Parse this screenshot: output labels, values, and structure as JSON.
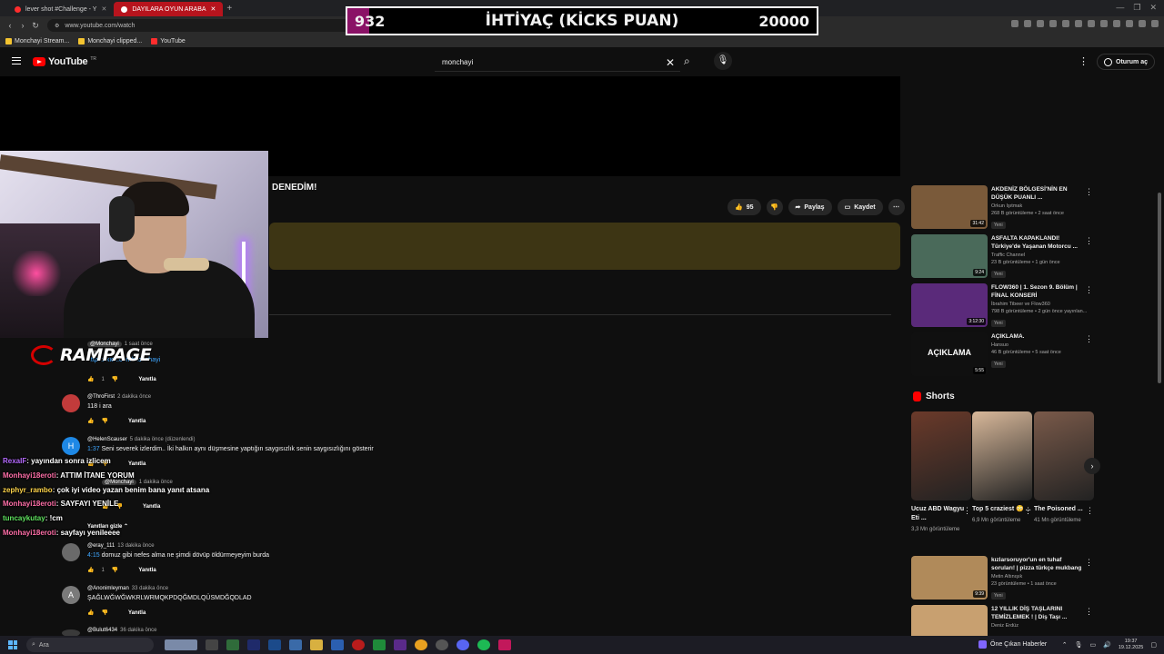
{
  "browser": {
    "tabs": [
      {
        "label": "lever shot #Challenge - Y",
        "active": false
      },
      {
        "label": "DAYILARA OYUN ARABA",
        "active": true
      }
    ],
    "url": "www.youtube.com/watch",
    "bookmarks": [
      "Monchayi Stream...",
      "Monchayi clipped...",
      "YouTube"
    ]
  },
  "overlay": {
    "current": "932",
    "label": "İHTİYAÇ (KİCKS PUAN)",
    "goal": "20000",
    "progress_fraction": 0.047,
    "accent": "#8a1266"
  },
  "youtube": {
    "logo_text": "YouTube",
    "country": "TR",
    "search_value": "monchayi",
    "sign_in": "Oturum aç"
  },
  "video": {
    "title_fragment": "DENEDİM!",
    "likes": "95",
    "share": "Paylaş",
    "save": "Kaydet"
  },
  "branding": {
    "rampage": "RAMPAGE"
  },
  "comments": [
    {
      "avatar": "",
      "user": "@Monchayi",
      "ago": "1 saat önce",
      "text": "GEL",
      "link": "https://kick.com/monchayi",
      "likes": "1",
      "reply": "Yanıtla"
    },
    {
      "avatar": "",
      "user": "@ThroFirst",
      "ago": "2 dakika önce",
      "text": "118 i ara",
      "likes": "",
      "reply": "Yanıtla"
    },
    {
      "avatar": "H",
      "user": "@HelenScauser",
      "ago": "5 dakika önce (düzenlendi)",
      "ts": "1:37",
      "text": "Seni severek izlerdim.. İki halkın aynı düşmesine yaptığın saygısızlık senin saygısızlığını gösterir",
      "likes": "",
      "reply": "Yanıtla"
    },
    {
      "avatar": "",
      "user": "@Monchayi",
      "ago": "1 dakika önce",
      "text": "",
      "likes": "",
      "reply": "Yanıtla"
    },
    {
      "avatar": "",
      "user": "@eray_111",
      "ago": "13 dakika önce",
      "ts": "4:15",
      "text": "domuz gibi nefes alma ne şimdi dövüp öldürmeyeyim burda",
      "likes": "1",
      "reply": "Yanıtla"
    },
    {
      "avatar": "A",
      "user": "@Anonimleyman",
      "ago": "33 dakika önce",
      "text": "ŞAĞLWĞWĞWKRLWRMQKPDQĞMDLQÜSMDĞQDLAD",
      "likes": "",
      "reply": "Yanıtla"
    },
    {
      "avatar": "",
      "user": "@Bulut6434",
      "ago": "36 dakika önce",
      "text": "",
      "likes": "",
      "reply": ""
    }
  ],
  "replies_toggle": "Yanıtları gizle",
  "chat": [
    {
      "user": "RexaIF",
      "color": "#b66bff",
      "msg": "yayından sonra izlicem"
    },
    {
      "user": "Monhayi18eroti",
      "color": "#ff6fa8",
      "msg": "ATTIM İTANE YORUM"
    },
    {
      "user": "zephyr_rambo",
      "color": "#ffd54a",
      "msg": "çok iyi video yazan benim bana yanıt atsana"
    },
    {
      "user": "Monhayi18eroti",
      "color": "#ff6fa8",
      "msg": "SAYFAYI YENİLE"
    },
    {
      "user": "tuncaykutay",
      "color": "#5fe35f",
      "msg": "!cm"
    },
    {
      "user": "Monhayi18eroti",
      "color": "#ff6fa8",
      "msg": "sayfayı yenileeee"
    }
  ],
  "recommendations": [
    {
      "title": "AKDENİZ BÖLGESİ'NİN EN DÜŞÜK PUANLI ...",
      "channel": "Orkun Işıtmak",
      "stats": "268 B görüntüleme • 2 saat önce",
      "badge": "Yeni",
      "duration": "31:42",
      "color": "#7a5a3a"
    },
    {
      "title": "ASFALTA KAPAKLANDI! Türkiye'de Yaşanan Motorcu ...",
      "channel": "Traffic Channel",
      "stats": "23 B görüntüleme • 1 gün önce",
      "badge": "Yeni",
      "duration": "9:24",
      "color": "#4a6a5a"
    },
    {
      "title": "FLOW360 | 1. Sezon 9. Bölüm | FİNAL KONSERİ",
      "channel": "İbrahim Tibeer ve Flow360",
      "stats": "798 B görüntüleme • 2 gün önce yayınlan...",
      "badge": "Yeni",
      "duration": "3:12:30",
      "color": "#5a2a7a"
    },
    {
      "title": "AÇIKLAMA.",
      "channel": "Hansuo",
      "stats": "46 B görüntüleme • 5 saat önce",
      "badge": "Yeni",
      "duration": "5:55",
      "color": "#101010",
      "thumb_text": "AÇIKLAMA"
    }
  ],
  "shorts": {
    "heading": "Shorts",
    "items": [
      {
        "title": "Ucuz ABD Wagyu Eti ...",
        "views": "3,3 Mn görüntüleme",
        "color": "#6b3a2a"
      },
      {
        "title": "Top 5 craziest 😳 ...",
        "views": "6,9 Mn görüntüleme",
        "color": "#d8b89a"
      },
      {
        "title": "The Poisoned ...",
        "views": "41 Mn görüntüleme",
        "color": "#7a5a4a"
      }
    ]
  },
  "more_recs": [
    {
      "title": "kızlarsoruyor'un en tuhaf soruları! | pizza türkçe mukbang",
      "channel": "Metin Altınışık",
      "stats": "23 görüntüleme • 1 saat önce",
      "badge": "Yeni",
      "duration": "9:39",
      "color": "#b08a5a"
    },
    {
      "title": "12 YILLIK DİŞ TAŞLARINI TEMİZLEMEK ! | Diş Taşı ...",
      "channel": "Deniz Erdüz",
      "stats": "",
      "badge": "",
      "duration": "",
      "color": "#c8a070"
    }
  ],
  "taskbar": {
    "search": "Ara",
    "news": "Öne Çıkan Haberler",
    "time": "19:37",
    "date": "19.12.2025"
  }
}
